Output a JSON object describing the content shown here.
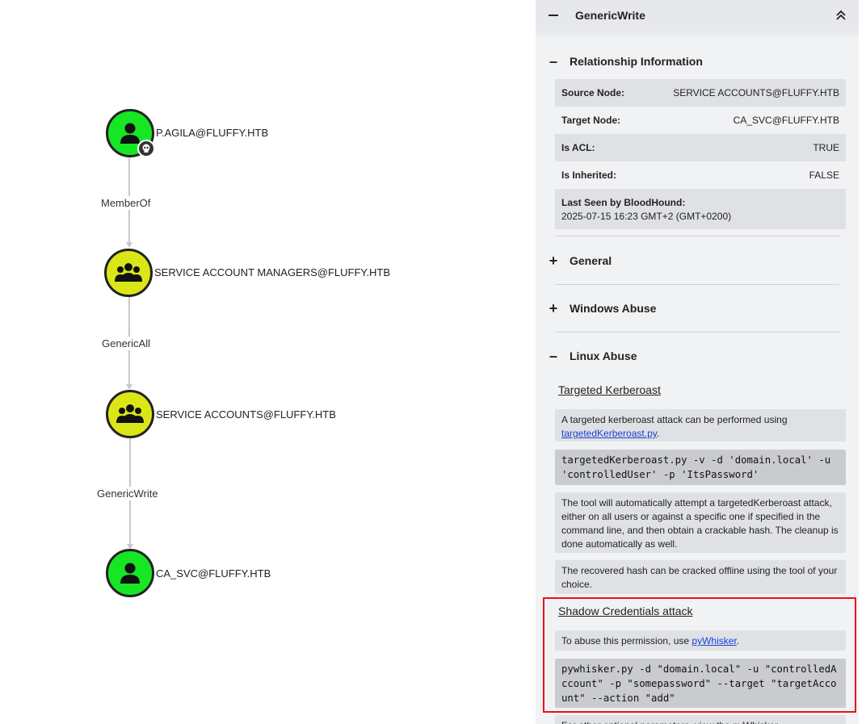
{
  "graph": {
    "nodes": [
      {
        "label": "P.AGILA@FLUFFY.HTB",
        "type": "user",
        "badge": "skull-icon"
      },
      {
        "label": "SERVICE ACCOUNT MANAGERS@FLUFFY.HTB",
        "type": "group"
      },
      {
        "label": "SERVICE ACCOUNTS@FLUFFY.HTB",
        "type": "group"
      },
      {
        "label": "CA_SVC@FLUFFY.HTB",
        "type": "user"
      }
    ],
    "edges": [
      {
        "label": "MemberOf"
      },
      {
        "label": "GenericAll"
      },
      {
        "label": "GenericWrite"
      }
    ],
    "colors": {
      "user": "#17e625",
      "group": "#dbe617"
    }
  },
  "panel": {
    "title": "GenericWrite",
    "collapse_icon": "double-chevron-up-icon",
    "relationship": {
      "title": "Relationship Information",
      "toggle": "–",
      "source_key": "Source Node:",
      "source_val": "SERVICE ACCOUNTS@FLUFFY.HTB",
      "target_key": "Target Node:",
      "target_val": "CA_SVC@FLUFFY.HTB",
      "acl_key": "Is ACL:",
      "acl_val": "TRUE",
      "inherited_key": "Is Inherited:",
      "inherited_val": "FALSE",
      "lastseen_key": "Last Seen by BloodHound:",
      "lastseen_val": "2025-07-15 16:23 GMT+2 (GMT+0200)"
    },
    "general": {
      "title": "General",
      "toggle": "+"
    },
    "windows_abuse": {
      "title": "Windows Abuse",
      "toggle": "+"
    },
    "linux_abuse": {
      "title": "Linux Abuse",
      "toggle": "–",
      "kerberoast": {
        "title": "Targeted Kerberoast",
        "intro": "A targeted kerberoast attack can be performed using ",
        "intro_link": "targetedKerberoast.py",
        "intro_end": ".",
        "command": "targetedKerberoast.py -v -d 'domain.local' -u 'controlledUser' -p 'ItsPassword'",
        "para1": "The tool will automatically attempt a targetedKerberoast attack, either on all users or against a specific one if specified in the command line, and then obtain a crackable hash. The cleanup is done automatically as well.",
        "para2": "The recovered hash can be cracked offline using the tool of your choice."
      },
      "shadow": {
        "title": "Shadow Credentials attack",
        "intro": "To abuse this permission, use ",
        "intro_link": "pyWhisker",
        "intro_end": ".",
        "command": "pywhisker.py -d \"domain.local\" -u \"controlledAccount\" -p \"somepassword\" --target \"targetAccount\" --action \"add\"",
        "para_cut": "For other optional parameters, view the pyWhisker"
      }
    }
  }
}
